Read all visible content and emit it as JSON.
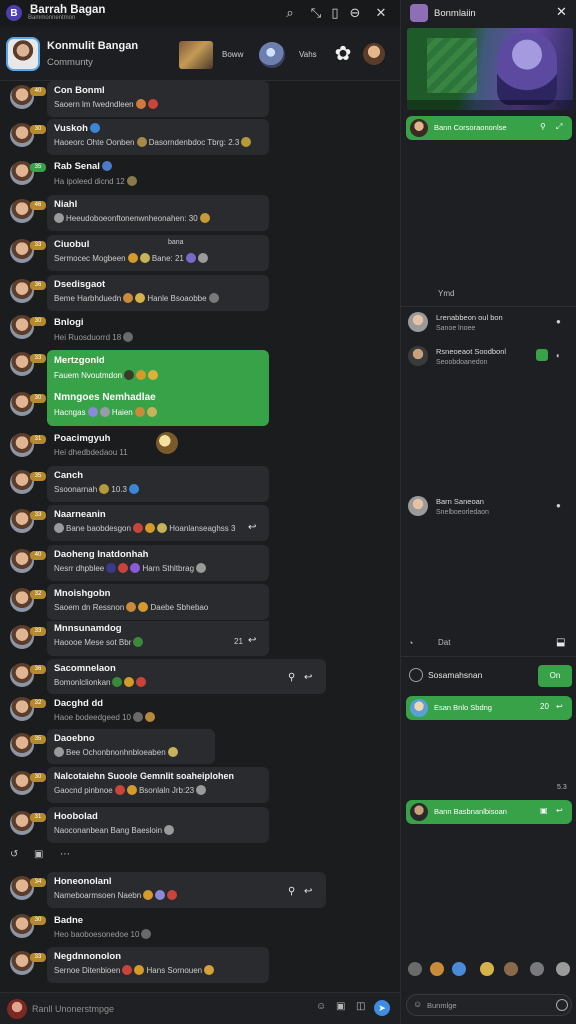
{
  "topbar": {
    "title": "Barrah Bagan",
    "subtitle": "Bammonnentmon",
    "icons": [
      "search-icon",
      "pin-icon",
      "info-icon",
      "minus-icon",
      "close-icon"
    ]
  },
  "community": {
    "name": "Konmulit Bangan",
    "subtitle": "Communty",
    "label1": "Boww",
    "label2": "Vahs"
  },
  "messages": [
    {
      "name": "Con Bonml",
      "text": "Saoern lm fwedndleen",
      "badge": "40"
    },
    {
      "name": "Vuskoh",
      "text": "Haoeorc Ohte Oonben",
      "badge": "30",
      "extra": "Dasorndenbdoc Tbrg: 2.3"
    },
    {
      "name": "Rab Senal",
      "text": "Ha ipoleed dicnd 12",
      "badge": "35"
    },
    {
      "name": "Niahl",
      "text": "Heeudoboeonftonenwnheonahen: 30",
      "badge": "46"
    },
    {
      "name": "Ciuobul",
      "text": "Sermocec Mogbeen",
      "badge": "33",
      "extra": "Bane: 21",
      "tag": "bana"
    },
    {
      "name": "Dsedisgaot",
      "text": "Beme Harbhduedn",
      "badge": "36",
      "extra": "Hanle Bsoaobbe"
    },
    {
      "name": "Bnlogi",
      "text": "Hei Ruosduorrd 18",
      "badge": "30"
    },
    {
      "name": "Mertzgonld",
      "text": "Fauem Nvoutmdon",
      "badge": "33"
    },
    {
      "name": "Nmngoes Nemhadlae",
      "text": "Hacngas",
      "badge": "30",
      "extra": "Haien"
    },
    {
      "name": "Poacimgyuh",
      "text": "Hei dhedbdedaou 11",
      "badge": "31"
    },
    {
      "name": "Canch",
      "text": "Ssoonarnah",
      "badge": "35",
      "extra": "10.3"
    },
    {
      "name": "Naarneanin",
      "text": "Bane baobdesgon",
      "badge": "33",
      "extra": "Hoanlanseaghss 3"
    },
    {
      "name": "Daoheng Inatdonhah",
      "text": "Nesrr dhpblee",
      "badge": "40",
      "extra": "Harn Sthltbrag"
    },
    {
      "name": "Mnoishgobn",
      "text": "Saoem dn Ressnon",
      "badge": "32",
      "extra": "Daebe Sbhebao"
    },
    {
      "name": "Mnnsunamdog",
      "text": "Haoooe Mese sot Bbr",
      "badge": "33",
      "extra": "21"
    },
    {
      "name": "Sacomnelaon",
      "text": "Bomonlclionkan",
      "badge": "36"
    },
    {
      "name": "Dacghd dd",
      "text": "Haoe bodeedgeed 10",
      "badge": "32"
    },
    {
      "name": "Daoebno",
      "text": "Bee Ochonbnonhnbloeaben",
      "badge": "35"
    },
    {
      "name": "Nalcotaiehn Suoole Gemnlit soaheiplohen",
      "text": "Gaocnd pinbnoe",
      "badge": "30",
      "extra": "Bsonlaln Jrb:23"
    },
    {
      "name": "Hoobolad",
      "text": "Naoconanbean",
      "badge": "31",
      "extra": "Bang Baesloin"
    },
    {
      "name": "Honeonolanl",
      "text": "Nameboarmsoen",
      "badge": "34",
      "extra": "Naebn"
    },
    {
      "name": "Badne",
      "text": "Heo baoboesonedoe 10",
      "badge": "30"
    },
    {
      "name": "Negdnnonolon",
      "text": "Sernoe Ditenbioen",
      "badge": "33",
      "extra": "Hans Sornouen"
    }
  ],
  "mid_actions": [
    "reply-icon",
    "image-icon",
    "more-icon"
  ],
  "composer": {
    "placeholder": "Ranll Unonerstmpge"
  },
  "right": {
    "title": "Bonmlaiin",
    "green1": "Bann Corsoraononlse",
    "section1": "Ymd",
    "item1": {
      "name": "Lrenabbeon oul bon",
      "sub": "Sanoe lnoee"
    },
    "item2": {
      "name": "Rsneoeaot Soodbonl",
      "sub": "Seoobdoanedon"
    },
    "item3": {
      "name": "Barn Saneoan",
      "sub": "Snelboeorledaon"
    },
    "section2": "Dat",
    "sub_header": {
      "title": "Sosamahsnan",
      "button": "On"
    },
    "green2": "Esan Bnlo Sbdng",
    "green2_meta": "20",
    "time": "5.3",
    "green3": "Bann Basbnanlbisoan",
    "composer_placeholder": "Bunmlge"
  },
  "colors": {
    "accent_green": "#37a247",
    "bubble": "#2a2b2f",
    "background": "#1b1c1e",
    "send_blue": "#3f8de0",
    "badge_gold": "#b48a2c"
  }
}
